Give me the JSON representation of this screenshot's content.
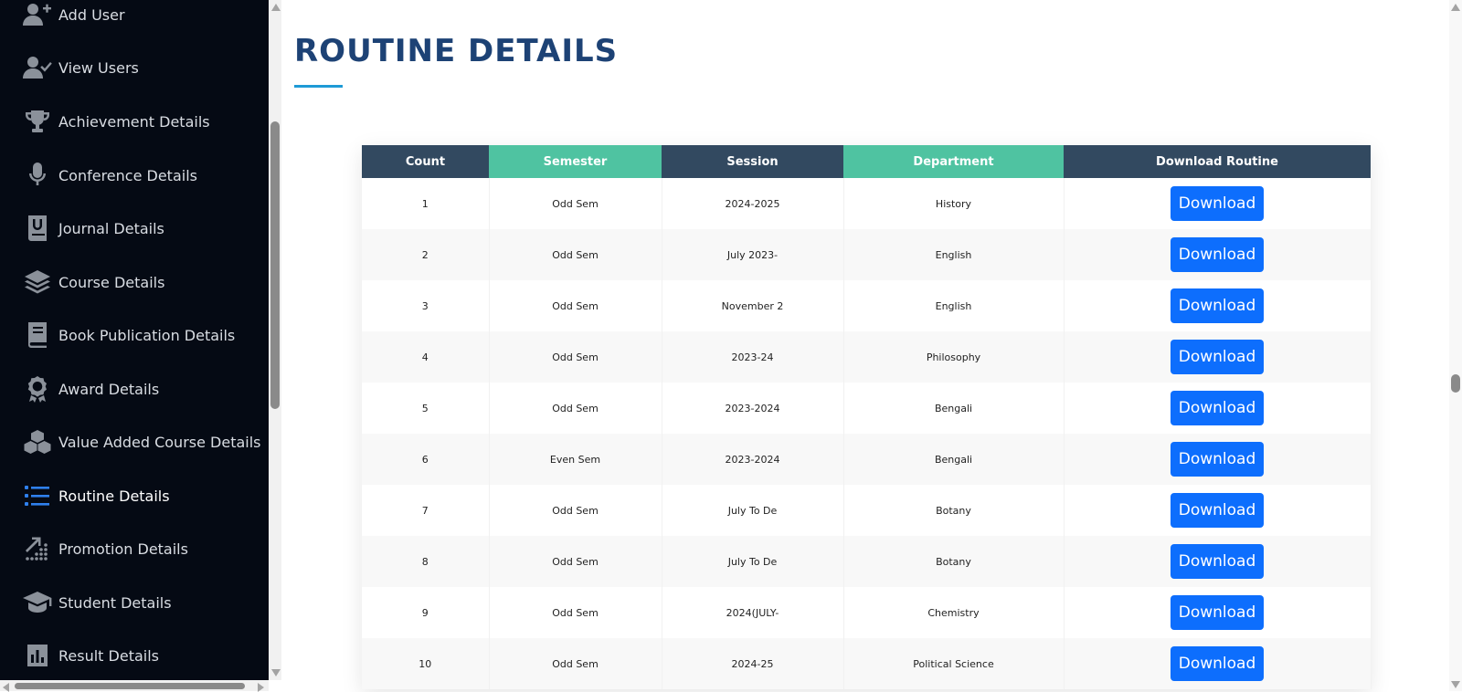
{
  "sidebar": {
    "items": [
      {
        "label": "Add User",
        "icon": "user-plus-icon"
      },
      {
        "label": "View Users",
        "icon": "user-check-icon"
      },
      {
        "label": "Achievement Details",
        "icon": "trophy-icon"
      },
      {
        "label": "Conference Details",
        "icon": "microphone-icon"
      },
      {
        "label": "Journal Details",
        "icon": "journal-icon"
      },
      {
        "label": "Course Details",
        "icon": "layers-icon"
      },
      {
        "label": "Book Publication Details",
        "icon": "book-icon"
      },
      {
        "label": "Award Details",
        "icon": "award-icon"
      },
      {
        "label": "Value Added Course Details",
        "icon": "cubes-icon"
      },
      {
        "label": "Routine Details",
        "icon": "list-icon",
        "active": true
      },
      {
        "label": "Promotion Details",
        "icon": "chart-dots-icon"
      },
      {
        "label": "Student Details",
        "icon": "graduation-cap-icon"
      },
      {
        "label": "Result Details",
        "icon": "bar-chart-icon"
      }
    ]
  },
  "main": {
    "title": "ROUTINE DETAILS",
    "table": {
      "headers": [
        "Count",
        "Semester",
        "Session",
        "Department",
        "Download Routine"
      ],
      "button_label": "Download",
      "rows": [
        {
          "count": "1",
          "semester": "Odd Sem",
          "session": "2024-2025",
          "department": "History"
        },
        {
          "count": "2",
          "semester": "Odd Sem",
          "session": "July 2023-",
          "department": "English"
        },
        {
          "count": "3",
          "semester": "Odd Sem",
          "session": "November 2",
          "department": "English"
        },
        {
          "count": "4",
          "semester": "Odd Sem",
          "session": "2023-24",
          "department": "Philosophy"
        },
        {
          "count": "5",
          "semester": "Odd Sem",
          "session": "2023-2024",
          "department": "Bengali"
        },
        {
          "count": "6",
          "semester": "Even Sem",
          "session": "2023-2024",
          "department": "Bengali"
        },
        {
          "count": "7",
          "semester": "Odd Sem",
          "session": "July To De",
          "department": "Botany"
        },
        {
          "count": "8",
          "semester": "Odd Sem",
          "session": "July To De",
          "department": "Botany"
        },
        {
          "count": "9",
          "semester": "Odd Sem",
          "session": "2024(JULY-",
          "department": "Chemistry"
        },
        {
          "count": "10",
          "semester": "Odd Sem",
          "session": "2024-25",
          "department": "Political Science"
        }
      ]
    }
  },
  "colors": {
    "sidebar_bg": "#050a14",
    "title": "#1d4275",
    "header_dark": "#324960",
    "header_green": "#4fc3a1",
    "button": "#0d6efd",
    "active_icon": "#2f80ed"
  }
}
